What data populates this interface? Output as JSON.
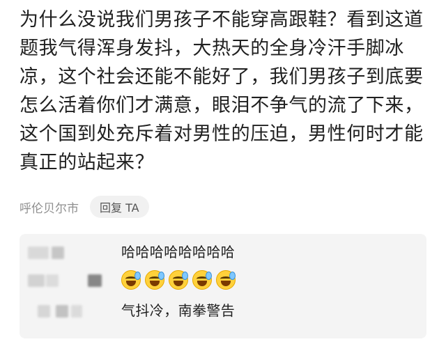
{
  "comment": {
    "text": "为什么没说我们男孩子不能穿高跟鞋？看到这道题我气得浑身发抖，大热天的全身冷汗手脚冰凉，这个社会还能不能好了，我们男孩子到底要怎么活着你们才满意，眼泪不争气的流了下来，这个国到处充斥着对男性的压迫，男性何时才能真正的站起来？",
    "location": "呼伦贝尔市",
    "reply_button_label": "回复 TA"
  },
  "replies": [
    {
      "text": "哈哈哈哈哈哈哈哈"
    },
    {
      "emoji_icons": [
        "grinning-sweat-icon",
        "grinning-sweat-icon",
        "grinning-sweat-icon",
        "grinning-sweat-icon",
        "grinning-sweat-icon"
      ]
    },
    {
      "text": "气抖冷，南拳警告"
    }
  ],
  "colors": {
    "background": "#ffffff",
    "reply_panel": "#f4f4f4",
    "muted_text": "#8f8f8f",
    "primary_text": "#1f1f1f"
  }
}
